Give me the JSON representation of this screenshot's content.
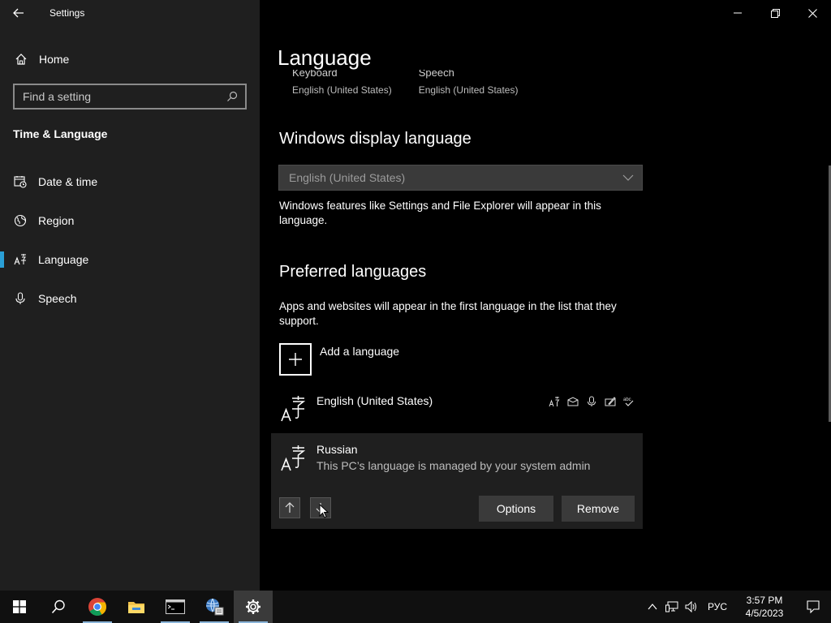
{
  "window": {
    "app_title": "Settings"
  },
  "sidebar": {
    "home_label": "Home",
    "search_placeholder": "Find a setting",
    "section_title": "Time & Language",
    "items": [
      {
        "label": "Date & time",
        "icon": "calendar-clock-icon"
      },
      {
        "label": "Region",
        "icon": "globe-icon"
      },
      {
        "label": "Language",
        "icon": "language-icon",
        "active": true
      },
      {
        "label": "Speech",
        "icon": "microphone-icon"
      }
    ]
  },
  "main": {
    "page_title": "Language",
    "clipped_tiles": [
      {
        "label": "Keyboard",
        "value": "English (United States)"
      },
      {
        "label": "Speech",
        "value": "English (United States)"
      }
    ],
    "display_language": {
      "heading": "Windows display language",
      "selected": "English (United States)",
      "description": "Windows features like Settings and File Explorer will appear in this language."
    },
    "preferred": {
      "heading": "Preferred languages",
      "description": "Apps and websites will appear in the first language in the list that they support.",
      "add_label": "Add a language",
      "languages": [
        {
          "name": "English (United States)",
          "subtitle": ""
        },
        {
          "name": "Russian",
          "subtitle": "This PC’s language is managed by your system admin"
        }
      ],
      "options_label": "Options",
      "remove_label": "Remove"
    }
  },
  "taskbar": {
    "apps": [
      "windows-start-icon",
      "search-icon",
      "chrome-icon",
      "file-explorer-icon",
      "command-prompt-icon",
      "network-globe-icon",
      "settings-gear-icon"
    ],
    "input_language": "РУС",
    "time": "3:57 PM",
    "date": "4/5/2023"
  },
  "colors": {
    "accent": "#2a9fd6",
    "sidebar_bg": "#1f1f1f",
    "main_bg": "#000000"
  }
}
